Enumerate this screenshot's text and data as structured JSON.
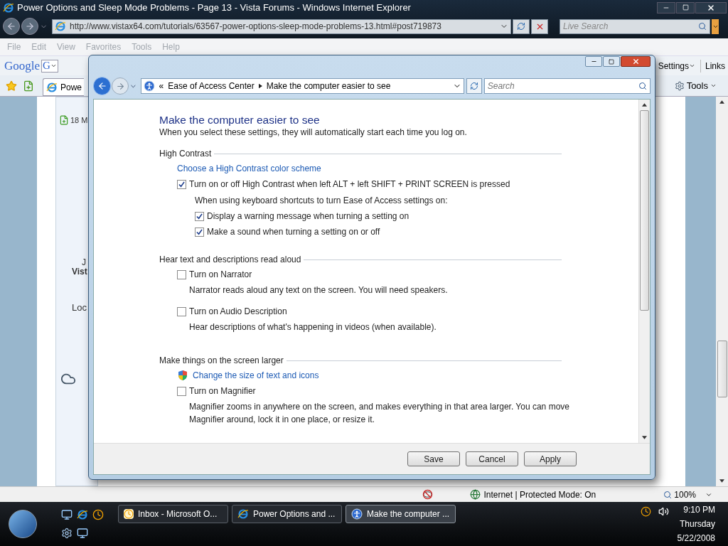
{
  "browser": {
    "title": "Power Options and Sleep Mode Problems - Page 13 - Vista Forums - Windows Internet Explorer",
    "address": "http://www.vistax64.com/tutorials/63567-power-options-sleep-mode-problems-13.html#post719873",
    "search_placeholder": "Live Search",
    "menu": [
      "File",
      "Edit",
      "View",
      "Favorites",
      "Tools",
      "Help"
    ],
    "google_toolbar": {
      "logo": "Google",
      "g_button": "G",
      "settings": "Settings",
      "links": "Links"
    },
    "tab": "Powe",
    "tools": "Tools",
    "page": {
      "attachment": "18 M",
      "name_top": "J",
      "name_bold": "Vist",
      "location": "Loc"
    },
    "status": {
      "zone": "Internet | Protected Mode: On",
      "zoom": "100%"
    }
  },
  "dialog": {
    "breadcrumb_root": "«",
    "breadcrumb": [
      "Ease of Access Center",
      "Make the computer easier to see"
    ],
    "search_placeholder": "Search",
    "heading": "Make the computer easier to see",
    "intro": "When you select these settings, they will automatically start each time you log on.",
    "sections": [
      {
        "title": "High Contrast",
        "items": [
          {
            "kind": "link",
            "label": "Choose a High Contrast color scheme"
          },
          {
            "kind": "checkbox",
            "label": "Turn on or off High Contrast when left ALT + left SHIFT + PRINT SCREEN is pressed",
            "checked": true,
            "children": [
              {
                "kind": "text",
                "label": "When using keyboard shortcuts to turn Ease of Access settings on:"
              },
              {
                "kind": "checkbox",
                "label": "Display a warning message when turning a setting on",
                "checked": true
              },
              {
                "kind": "checkbox",
                "label": "Make a sound when turning a setting on or off",
                "checked": true
              }
            ]
          }
        ]
      },
      {
        "title": "Hear text and descriptions read aloud",
        "items": [
          {
            "kind": "checkbox",
            "label": "Turn on Narrator",
            "checked": false,
            "description": "Narrator reads aloud any text on the screen. You will need speakers."
          },
          {
            "kind": "checkbox",
            "label": "Turn on Audio Description",
            "checked": false,
            "description": "Hear descriptions of what's happening in videos (when available)."
          }
        ]
      },
      {
        "title": "Make things on the screen larger",
        "items": [
          {
            "kind": "shield-link",
            "label": "Change the size of text and icons"
          },
          {
            "kind": "checkbox",
            "label": "Turn on Magnifier",
            "checked": false,
            "description": "Magnifier zooms in anywhere on the screen, and makes everything in that area larger. You can move Magnifier around, lock it in one place, or resize it."
          }
        ]
      }
    ],
    "buttons": [
      "Save",
      "Cancel",
      "Apply"
    ]
  },
  "taskbar": {
    "buttons": [
      {
        "label": "Inbox - Microsoft O...",
        "selected": false
      },
      {
        "label": "Power Options and ...",
        "selected": false
      },
      {
        "label": "Make the computer ...",
        "selected": true
      }
    ],
    "time": "9:10 PM",
    "day": "Thursday",
    "date": "5/22/2008"
  }
}
